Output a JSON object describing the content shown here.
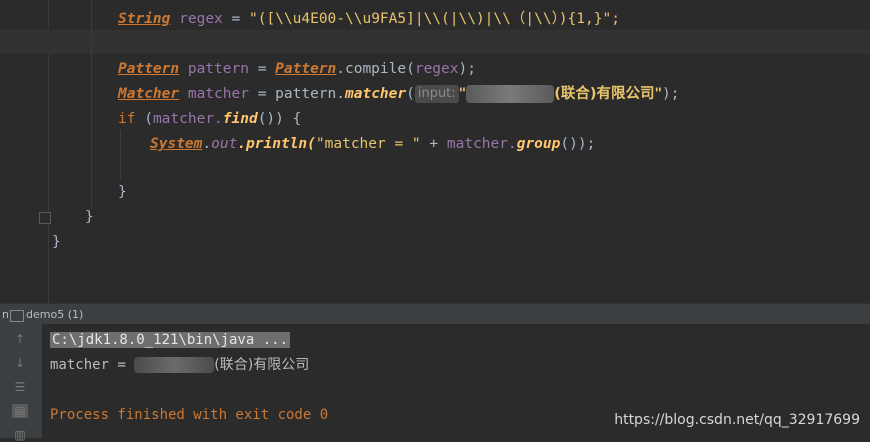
{
  "editor": {
    "line_regex": {
      "type": "String",
      "name": "regex",
      "eq": "=",
      "value": "\"([\\\\u4E00-\\\\u9FA5]|\\\\(|\\\\)|\\\\（|\\\\）){1,}\";"
    },
    "line_pattern": {
      "type": "Pattern",
      "name": "pattern",
      "eq": "=",
      "class": "Pattern",
      "call": ".compile(",
      "arg": "regex",
      "end": ");"
    },
    "line_matcher": {
      "type": "Matcher",
      "name": "matcher",
      "eq": "=",
      "obj": "pattern.",
      "method": "matcher",
      "open": "(",
      "hint": "input:",
      "str_prefix": "\"",
      "str_suffix": "(联合)有限公司\"",
      "end": ");"
    },
    "line_if": {
      "kw": "if",
      "open": "(",
      "obj": "matcher.",
      "method": "find",
      "close": "()) {"
    },
    "line_print": {
      "class": "System",
      "dot": ".",
      "field": "out",
      "method": ".println(",
      "str": "\"matcher = \"",
      "plus": " + ",
      "obj": "matcher.",
      "method2": "group",
      "end": "());"
    },
    "brace_inner": "}",
    "brace_method": "}",
    "brace_class": "}"
  },
  "run_panel": {
    "tab_label": "demo5 (1)"
  },
  "console": {
    "cmd": "C:\\jdk1.8.0_121\\bin\\java ...",
    "output_prefix": "matcher = ",
    "output_suffix": "(联合)有限公司",
    "finish": "Process finished with exit code 0"
  },
  "watermark": "https://blog.csdn.net/qq_32917699",
  "colors": {
    "background": "#2b2b2b",
    "keyword": "#cc7832",
    "string": "#e8c46a",
    "variable": "#9876aa",
    "method": "#ffc66d"
  }
}
